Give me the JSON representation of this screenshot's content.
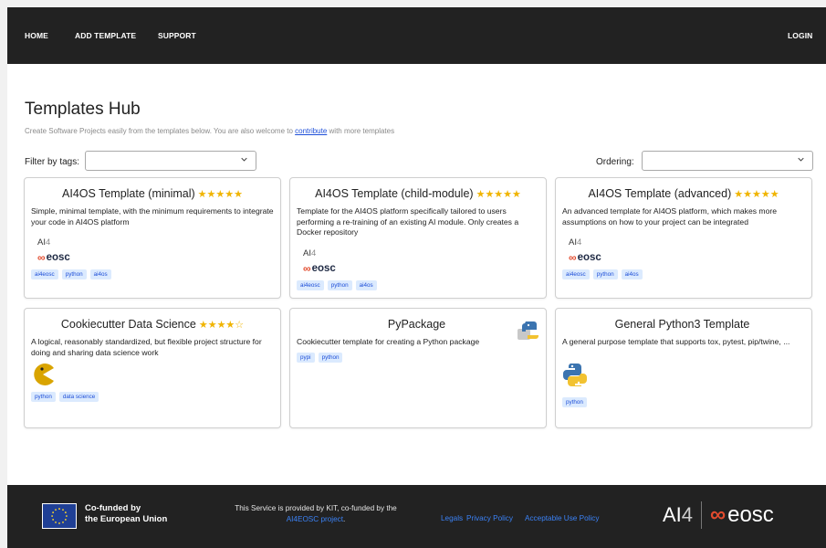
{
  "nav": {
    "home": "HOME",
    "add_template": "ADD TEMPLATE",
    "support": "SUPPORT",
    "login": "LOGIN"
  },
  "header": {
    "title": "Templates Hub",
    "subtitle_prefix": "Create Software Projects easily from the templates below. You are also welcome to ",
    "subtitle_link": "contribute",
    "subtitle_suffix": " with more templates"
  },
  "filters": {
    "filter_label": "Filter by tags:",
    "filter_value": "",
    "ordering_label": "Ordering:",
    "ordering_value": ""
  },
  "cards": [
    {
      "title": "AI4OS Template (minimal)",
      "stars": "★★★★★",
      "rating": 5,
      "description": "Simple, minimal template, with the minimum requirements to integrate your code in AI4OS platform",
      "logo": "ai4eosc-logo",
      "tags": [
        "ai4eosc",
        "python",
        "ai4os"
      ]
    },
    {
      "title": "AI4OS Template (child-module)",
      "stars": "★★★★★",
      "rating": 5,
      "description": "Template for the AI4OS platform specifically tailored to users performing a re-training of an existing AI module. Only creates a Docker repository",
      "logo": "ai4eosc-logo",
      "tags": [
        "ai4eosc",
        "python",
        "ai4os"
      ]
    },
    {
      "title": "AI4OS Template (advanced)",
      "stars": "★★★★★",
      "rating": 5,
      "description": "An advanced template for AI4OS platform, which makes more assumptions on how to your project can be integrated",
      "logo": "ai4eosc-logo",
      "tags": [
        "ai4eosc",
        "python",
        "ai4os"
      ]
    },
    {
      "title": "Cookiecutter Data Science",
      "stars": "★★★★☆",
      "rating": 4,
      "description": "A logical, reasonably standardized, but flexible project structure for doing and sharing data science work",
      "logo": "pacman-logo",
      "tags": [
        "python",
        "data science"
      ]
    },
    {
      "title": "PyPackage",
      "stars": "",
      "rating": null,
      "description": "Cookiecutter template for creating a Python package",
      "logo": "python-package-logo",
      "tags": [
        "pypi",
        "python"
      ]
    },
    {
      "title": "General Python3 Template",
      "stars": "",
      "rating": null,
      "description": "A general purpose template that supports tox, pytest, pip/twine, ...",
      "logo": "python-logo",
      "tags": [
        "python"
      ]
    }
  ],
  "logo_text": {
    "ai": "AI",
    "four": "4",
    "eosc": "eosc",
    "inf": "∞"
  },
  "footer": {
    "eu_line1": "Co-funded by",
    "eu_line2": "the European Union",
    "service_text": "This Service is provided by KIT, co-funded by the",
    "service_link": "AI4EOSC project",
    "service_end": ".",
    "legals": "Legals",
    "privacy": "Privacy Policy",
    "aup": "Acceptable Use Policy"
  },
  "colors": {
    "nav_bg": "#222222",
    "star": "#f0b400",
    "tag_bg": "#dbeafe",
    "tag_text": "#1d4ed8",
    "link": "#3b82f6",
    "eosc_accent": "#e24b2e"
  }
}
